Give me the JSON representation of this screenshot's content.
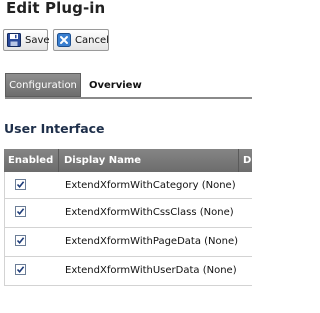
{
  "page": {
    "title": "Edit Plug-in"
  },
  "toolbar": {
    "save_label": "Save",
    "cancel_label": "Cancel"
  },
  "tabs": [
    {
      "label": "Configuration",
      "active": true
    },
    {
      "label": "Overview",
      "active": false
    }
  ],
  "section": {
    "title": "User Interface"
  },
  "table": {
    "columns": [
      "Enabled",
      "Display Name",
      "D"
    ],
    "rows": [
      {
        "enabled": true,
        "name": "ExtendXformWithCategory (None)"
      },
      {
        "enabled": true,
        "name": "ExtendXformWithCssClass (None)"
      },
      {
        "enabled": true,
        "name": "ExtendXformWithPageData (None)"
      },
      {
        "enabled": true,
        "name": "ExtendXformWithUserData (None)"
      }
    ]
  },
  "icons": {
    "save": "floppy-disk-icon",
    "cancel": "cancel-x-icon"
  },
  "colors": {
    "accent": "#1e2f4a",
    "header_bg": "#777777",
    "checkbox_border": "#6b7d96"
  }
}
